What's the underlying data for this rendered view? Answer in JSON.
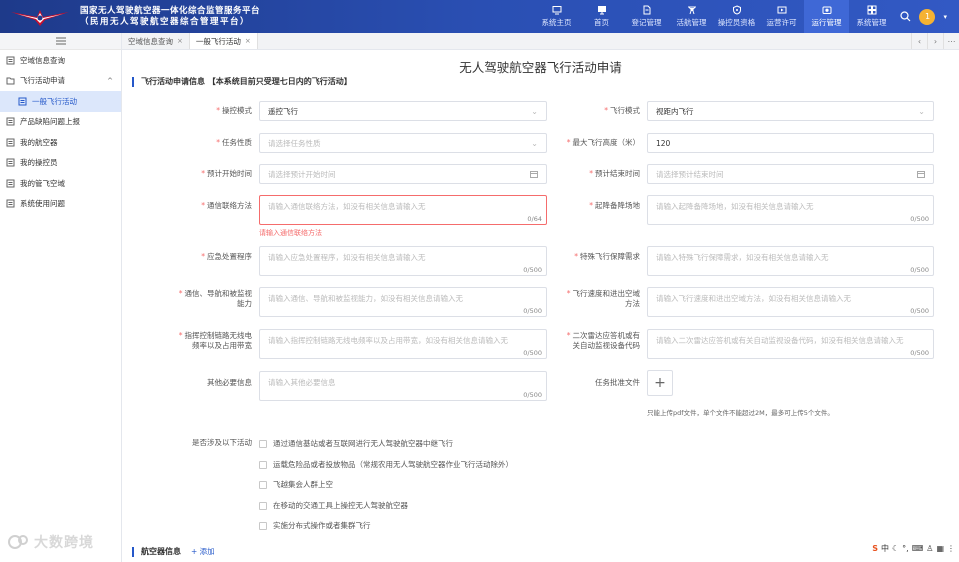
{
  "header": {
    "title_line1": "国家无人驾驶航空器一体化综合监管服务平台",
    "title_line2": "（民用无人驾驶航空器综合管理平台）",
    "nav": [
      {
        "label": "系统主页",
        "icon": "screen-icon"
      },
      {
        "label": "首页",
        "icon": "monitor-icon"
      },
      {
        "label": "登记管理",
        "icon": "document-icon"
      },
      {
        "label": "活航管理",
        "icon": "drone-icon"
      },
      {
        "label": "操控员资格",
        "icon": "shield-icon"
      },
      {
        "label": "运营许可",
        "icon": "play-icon"
      },
      {
        "label": "运行管理",
        "icon": "camera-icon"
      },
      {
        "label": "系统管理",
        "icon": "grid-icon"
      }
    ],
    "active_nav": 6,
    "avatar_text": "1",
    "colors": {
      "header_bg": "#2a4fb3",
      "active_nav": "#3f68d6",
      "accent": "#2558c9",
      "error": "#f56c6c"
    }
  },
  "sidebar": {
    "items": [
      {
        "label": "空域信息查询",
        "icon": "doc-icon"
      },
      {
        "label": "飞行活动申请",
        "icon": "folder-icon",
        "chevron": "^"
      },
      {
        "label": "一般飞行活动",
        "icon": "doc-icon"
      },
      {
        "label": "产品缺陷问题上报",
        "icon": "doc-icon"
      },
      {
        "label": "我的航空器",
        "icon": "doc-icon"
      },
      {
        "label": "我的操控员",
        "icon": "doc-icon"
      },
      {
        "label": "我的管飞空域",
        "icon": "doc-icon"
      },
      {
        "label": "系统使用问题",
        "icon": "doc-icon"
      }
    ]
  },
  "tabs": [
    {
      "label": "空域信息查询",
      "close": "×"
    },
    {
      "label": "一般飞行活动",
      "close": "×"
    }
  ],
  "tab_controls": [
    "‹",
    "›",
    "⋯"
  ],
  "page": {
    "title": "无人驾驶航空器飞行活动申请",
    "section1": "飞行活动申请信息 【本系统目前只受理七日内的飞行活动】",
    "section2": "航空器信息",
    "add_label": "+ 添加"
  },
  "form": {
    "control_mode": {
      "label": "操控模式",
      "value": "遥控飞行"
    },
    "flight_mode": {
      "label": "飞行模式",
      "value": "视距内飞行"
    },
    "task_type": {
      "label": "任务性质",
      "placeholder": "请选择任务性质"
    },
    "max_altitude": {
      "label": "最大飞行高度（米）",
      "value": "120"
    },
    "start_time": {
      "label": "预计开始时间",
      "placeholder": "请选择预计开始时间"
    },
    "end_time": {
      "label": "预计结束时间",
      "placeholder": "请选择预计结束时间"
    },
    "comm_contact": {
      "label": "通信联络方法",
      "placeholder": "请输入通信联络方法，如没有相关信息请输入无",
      "count": "0/64",
      "error": "请输入通信联络方法"
    },
    "takeoff_site": {
      "label": "起降备降场地",
      "placeholder": "请输入起降备降场地，如没有相关信息请输入无",
      "count": "0/500"
    },
    "emergency": {
      "label": "应急处置程序",
      "placeholder": "请输入应急处置程序，如没有相关信息请输入无",
      "count": "0/500"
    },
    "special_needs": {
      "label": "特殊飞行保障需求",
      "placeholder": "请输入特殊飞行保障需求，如没有相关信息请输入无",
      "count": "0/500"
    },
    "cnav": {
      "label1": "通信、导航和被监视",
      "label2": "能力",
      "placeholder": "请输入通信、导航和被监视能力，如没有相关信息请输入无",
      "count": "0/500"
    },
    "speed_airspace": {
      "label1": "飞行速度和进出空域",
      "label2": "方法",
      "placeholder": "请输入飞行速度和进出空域方法，如没有相关信息请输入无",
      "count": "0/500"
    },
    "link_freq": {
      "label1": "指挥控制链路无线电",
      "label2": "频率以及占用带宽",
      "placeholder": "请输入指挥控制链路无线电频率以及占用带宽，如没有相关信息请输入无",
      "count": "0/500"
    },
    "transponder": {
      "label1": "二次雷达应答机或有",
      "label2": "关自动监视设备代码",
      "placeholder": "请输入二次雷达应答机或有关自动监视设备代码，如没有相关信息请输入无",
      "count": "0/500"
    },
    "other_info": {
      "label": "其他必要信息",
      "placeholder": "请输入其他必要信息",
      "count": "0/500"
    },
    "approval_file": {
      "label": "任务批准文件",
      "hint": "只能上传pdf文件，单个文件不能超过2M，最多可上传5个文件。"
    },
    "activities": {
      "label": "是否涉及以下活动",
      "options": [
        "通过通信基站或者互联网进行无人驾驶航空器中继飞行",
        "运载危险品或者投放物品（常规农用无人驾驶航空器作业飞行活动除外）",
        "飞越集会人群上空",
        "在移动的交通工具上操控无人驾驶航空器",
        "实施分布式操作或者集群飞行"
      ]
    }
  },
  "watermark": "大数跨境",
  "ime_bar": "中"
}
